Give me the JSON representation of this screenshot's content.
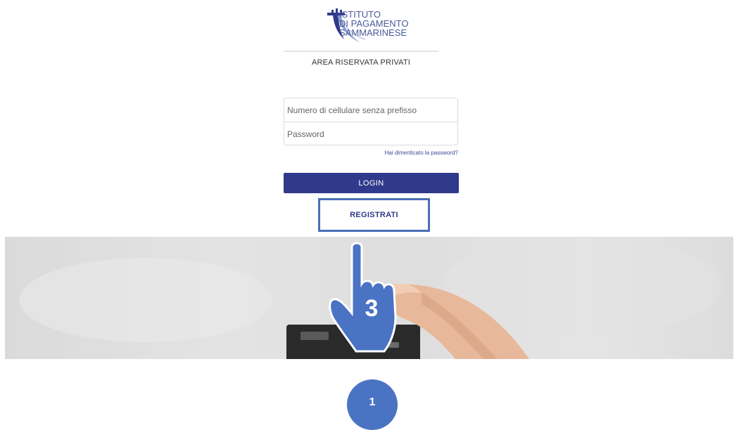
{
  "logo": {
    "line1": "ISTITUTO",
    "line2": "DI PAGAMENTO",
    "line3": "SAMMARINESE",
    "icon": "tower-logo-icon"
  },
  "area_title": "AREA RISERVATA PRIVATI",
  "form": {
    "phone_placeholder": "Numero di cellulare senza prefisso",
    "password_placeholder": "Password",
    "forgot_link": "Hai dimenticato la password?"
  },
  "login_label": "LOGIN",
  "register_label": "REGISTRATI",
  "annotations": {
    "hand_icon": "pointing-hand-icon",
    "hand_step": "3",
    "step_badge": "1"
  },
  "colors": {
    "brand_blue": "#2f3a8c",
    "highlight_blue": "#4a6fb5",
    "badge_blue": "#4a73c4"
  }
}
